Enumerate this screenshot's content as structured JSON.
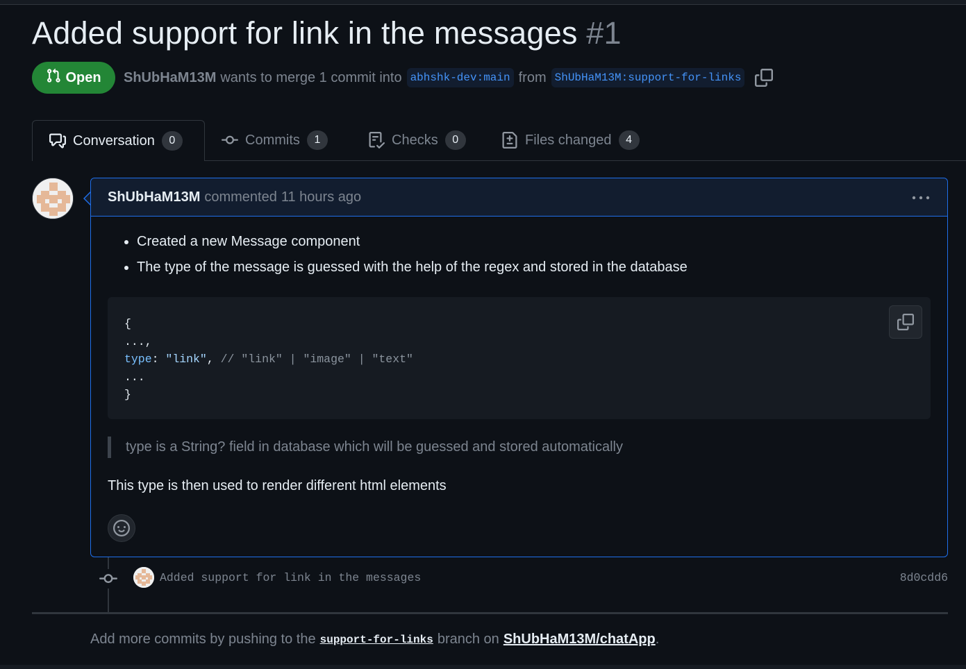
{
  "pr": {
    "title": "Added support for link in the messages",
    "number": "#1",
    "state": "Open",
    "author": "ShUbHaM13M",
    "merge_text": "wants to merge 1 commit into",
    "base_branch": "abhshk-dev:main",
    "from_text": "from",
    "head_branch": "ShUbHaM13M:support-for-links"
  },
  "tabs": [
    {
      "label": "Conversation",
      "count": "0",
      "icon": "comment-discussion-icon"
    },
    {
      "label": "Commits",
      "count": "1",
      "icon": "git-commit-icon"
    },
    {
      "label": "Checks",
      "count": "0",
      "icon": "checklist-icon"
    },
    {
      "label": "Files changed",
      "count": "4",
      "icon": "file-diff-icon"
    }
  ],
  "comment": {
    "author": "ShUbHaM13M",
    "action": "commented",
    "time": "11 hours ago",
    "points": [
      "Created a new Message component",
      "The type of the message is guessed with the help of the regex and stored in the database"
    ],
    "code": {
      "line1": "{",
      "line2": "...,",
      "key": "type",
      "colon": ": ",
      "value": "\"link\"",
      "comma": ", ",
      "comment": "// \"link\" | \"image\" | \"text\"",
      "line4": "...",
      "line5": "}"
    },
    "quote": "type is a String? field in database which will be guessed and stored automatically",
    "paragraph": "This type is then used to render different html elements"
  },
  "commit": {
    "message": "Added support for link in the messages",
    "sha": "8d0cdd6"
  },
  "footer": {
    "prefix": "Add more commits by pushing to the",
    "branch": "support-for-links",
    "middle": "branch on",
    "repo": "ShUbHaM13M/chatApp",
    "suffix": "."
  },
  "colors": {
    "background": "#0d1117",
    "open_badge": "#238636",
    "accent_blue": "#1f6feb",
    "link_blue": "#4493f8"
  }
}
